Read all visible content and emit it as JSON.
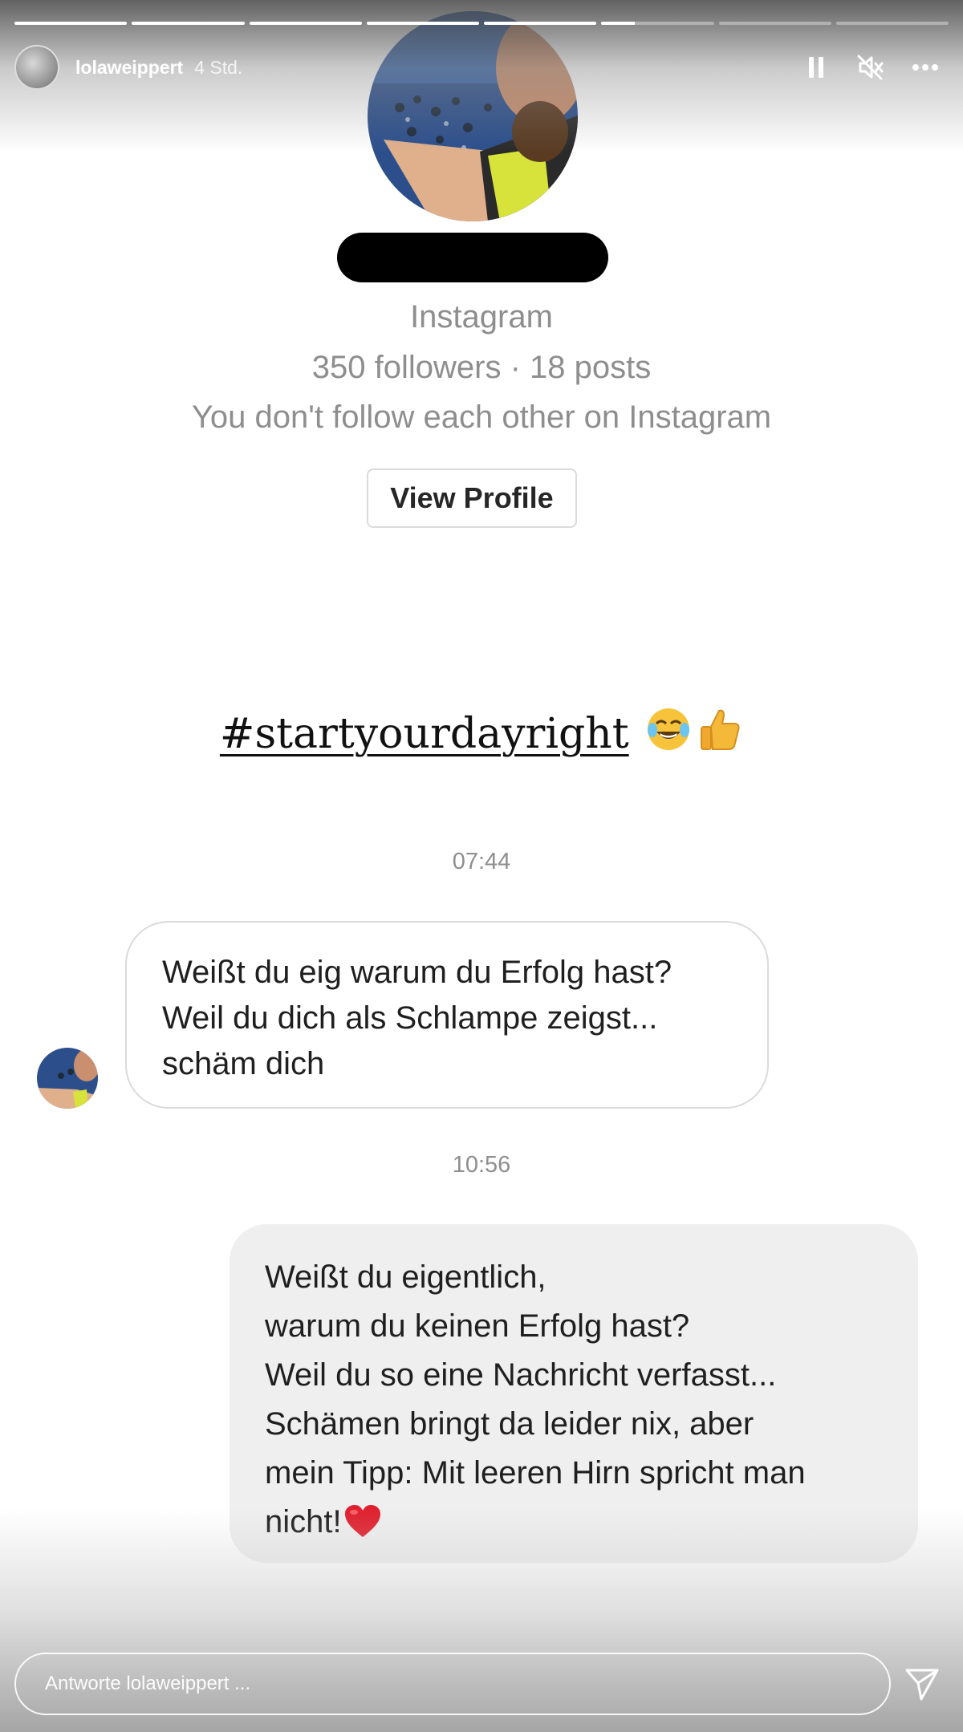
{
  "story": {
    "segments": [
      {
        "progress": 1
      },
      {
        "progress": 1
      },
      {
        "progress": 1
      },
      {
        "progress": 1
      },
      {
        "progress": 1
      },
      {
        "progress": 0.3
      },
      {
        "progress": 0
      },
      {
        "progress": 0
      }
    ],
    "username": "lolaweippert",
    "time_ago": "4 Std.",
    "actions": [
      "pause-icon",
      "mute-icon",
      "more-options-icon"
    ]
  },
  "dm": {
    "platform": "Instagram",
    "stats": "350 followers · 18 posts",
    "follow_status": "You don't follow each other on Instagram",
    "view_profile_label": "View Profile"
  },
  "hashtag": {
    "text": "#startyourdayright",
    "emojis": [
      "tears-of-joy-emoji",
      "thumbs-up-emoji"
    ]
  },
  "messages": [
    {
      "timestamp": "07:44",
      "direction": "incoming",
      "lines": [
        "Weißt du eig warum du Erfolg hast?",
        "Weil du dich als Schlampe zeigst...",
        "schäm dich"
      ]
    },
    {
      "timestamp": "10:56",
      "direction": "outgoing",
      "lines": [
        "Weißt du eigentlich,",
        "warum du keinen Erfolg hast?",
        "Weil du so eine Nachricht verfasst...",
        "Schämen bringt da leider nix, aber",
        "mein Tipp: Mit leeren Hirn spricht man",
        "nicht!"
      ],
      "trailing_emoji": "red-heart-emoji"
    }
  ],
  "reply": {
    "placeholder": "Antworte lolaweippert ..."
  },
  "colors": {
    "secondary_text": "#8e8e8e",
    "incoming_border": "#dbdbdb",
    "outgoing_bg": "#efefef",
    "heart": "#e0202e"
  }
}
